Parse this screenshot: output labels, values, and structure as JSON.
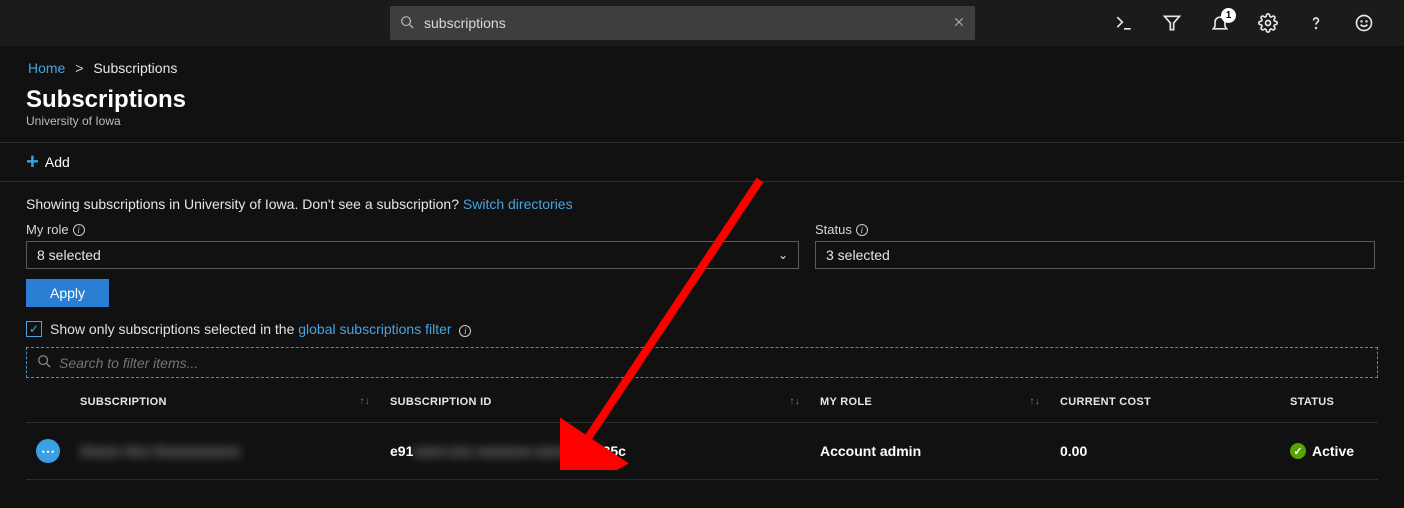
{
  "topbar": {
    "search_value": "subscriptions",
    "notifications_count": "1"
  },
  "breadcrumb": {
    "home": "Home",
    "current": "Subscriptions"
  },
  "page": {
    "title": "Subscriptions",
    "subtitle": "University of Iowa"
  },
  "cmdbar": {
    "add_label": "Add"
  },
  "info": {
    "prefix": "Showing subscriptions in University of Iowa. Don't see a subscription? ",
    "link": "Switch directories"
  },
  "filters": {
    "role_label": "My role",
    "role_value": "8 selected",
    "status_label": "Status",
    "status_value": "3 selected",
    "apply_label": "Apply"
  },
  "checkbox": {
    "prefix": "Show only subscriptions selected in the ",
    "link": "global subscriptions filter"
  },
  "grid": {
    "filter_placeholder": "Search to filter items...",
    "headers": {
      "subscription": "SUBSCRIPTION",
      "subscription_id": "SUBSCRIPTION ID",
      "my_role": "MY ROLE",
      "current_cost": "CURRENT COST",
      "status": "STATUS"
    },
    "rows": [
      {
        "name_hidden": "Xxxxx Xxx Xxxxxxxxxxx",
        "id_prefix": "e91",
        "id_hidden": "xxxx-xxx xxxxxxx-xxxx-xxxx",
        "id_suffix": "85c",
        "role": "Account admin",
        "cost": "0.00",
        "status": "Active"
      }
    ]
  }
}
